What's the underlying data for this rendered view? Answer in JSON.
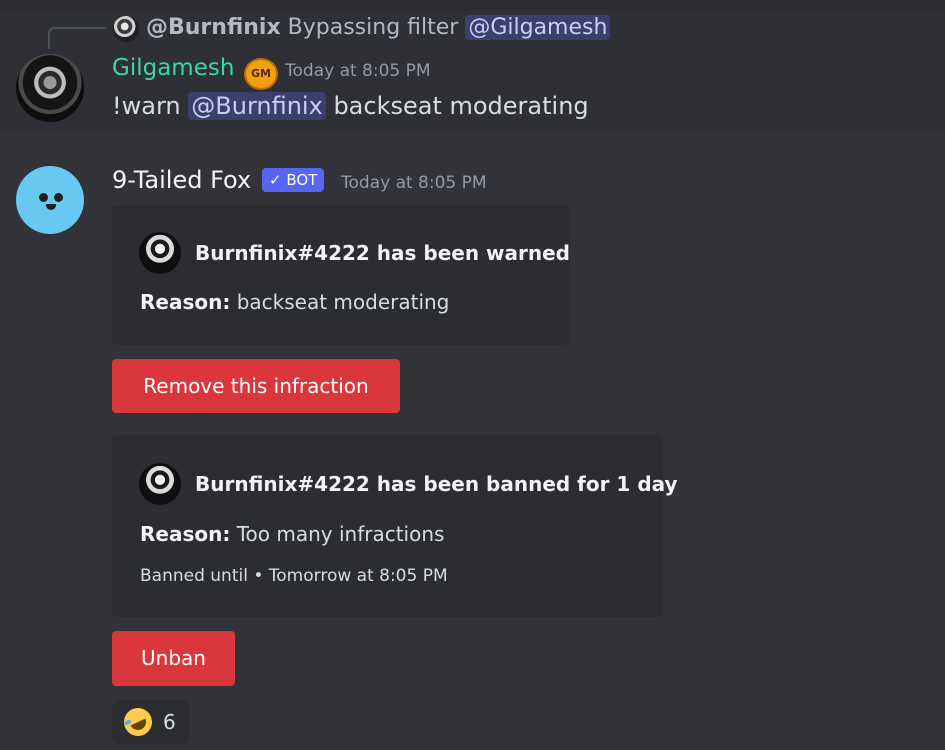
{
  "reply": {
    "author": "@Burnfinix",
    "content": "Bypassing filter",
    "mention": "@Gilgamesh"
  },
  "message1": {
    "author": "Gilgamesh",
    "author_color": "#3ed6a4",
    "badge_text": "GM",
    "timestamp": "Today at 8:05 PM",
    "command": "!warn",
    "mention": "@Burnfinix",
    "text": "backseat moderating"
  },
  "message2": {
    "author": "9-Tailed Fox",
    "bot_tag": "✓ BOT",
    "timestamp": "Today at 8:05 PM",
    "embed1": {
      "title": "Burnfinix#4222 has been warned",
      "reason_label": "Reason:",
      "reason_value": "backseat moderating"
    },
    "button1": "Remove this infraction",
    "embed2": {
      "title": "Burnfinix#4222 has been banned for 1 day",
      "reason_label": "Reason:",
      "reason_value": "Too many infractions",
      "footer": "Banned until • Tomorrow at 8:05 PM"
    },
    "button2": "Unban",
    "reaction": {
      "emoji": "rolling-on-floor-laughing-icon",
      "count": "6"
    }
  },
  "colors": {
    "background": "#313338",
    "embed_bg": "#2b2d31",
    "danger_button": "#da373c",
    "bot_tag": "#5865f2",
    "mention_bg": "rgba(88,101,242,0.3)"
  }
}
